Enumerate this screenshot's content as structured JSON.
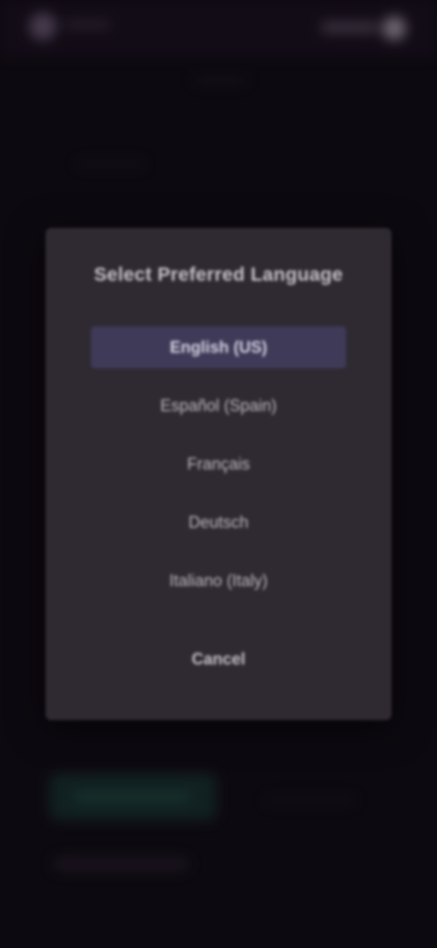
{
  "modal": {
    "title": "Select Preferred Language",
    "options": [
      {
        "label": "English (US)",
        "selected": true
      },
      {
        "label": "Español (Spain)",
        "selected": false
      },
      {
        "label": "Français",
        "selected": false
      },
      {
        "label": "Deutsch",
        "selected": false
      },
      {
        "label": "Italiano (Italy)",
        "selected": false
      }
    ],
    "cancel_label": "Cancel"
  },
  "colors": {
    "page_background": "#0f0b12",
    "modal_background": "#2f2a31",
    "selected_option": "#3e3a58",
    "background_primary_button": "#15302c"
  }
}
